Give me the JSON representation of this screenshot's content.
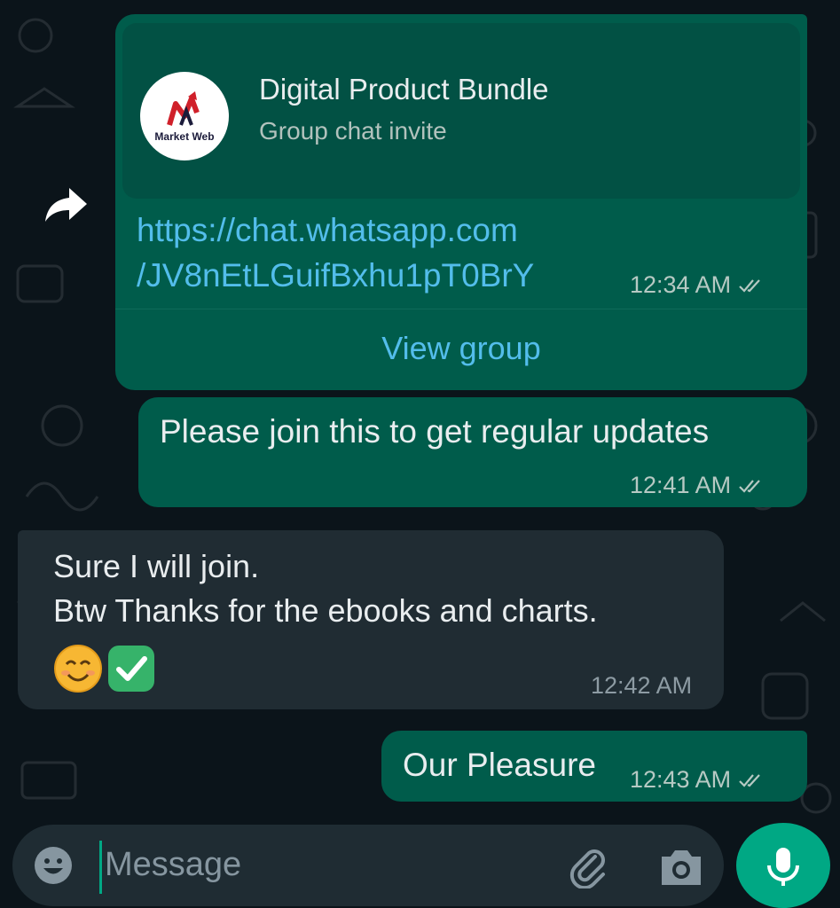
{
  "chat": {
    "invite": {
      "group_name": "Digital Product Bundle",
      "subtitle": "Group chat invite",
      "logo_text": "Market Web",
      "link_line1": "https://chat.whatsapp.com",
      "link_line2": "/JV8nEtLGuifBxhu1pT0BrY",
      "time": "12:34 AM",
      "action_label": "View group"
    },
    "messages": [
      {
        "direction": "outgoing",
        "text": "Please join this to get regular updates",
        "time": "12:41 AM"
      },
      {
        "direction": "incoming",
        "line1": "Sure I will join.",
        "line2": "Btw Thanks for the ebooks and charts.",
        "emoji": "😊✅",
        "time": "12:42 AM"
      },
      {
        "direction": "outgoing",
        "text": "Our Pleasure",
        "time": "12:43 AM"
      }
    ]
  },
  "composer": {
    "placeholder": "Message",
    "value": ""
  },
  "icons": {
    "forward": "forward-icon",
    "read_receipt": "double-check-icon",
    "emoji": "emoji-icon",
    "attach": "paperclip-icon",
    "camera": "camera-icon",
    "mic": "microphone-icon"
  },
  "colors": {
    "outgoing_bubble": "#005c4b",
    "incoming_bubble": "#202c33",
    "link": "#53bdeb",
    "accent": "#00a884",
    "background": "#0b141a"
  }
}
